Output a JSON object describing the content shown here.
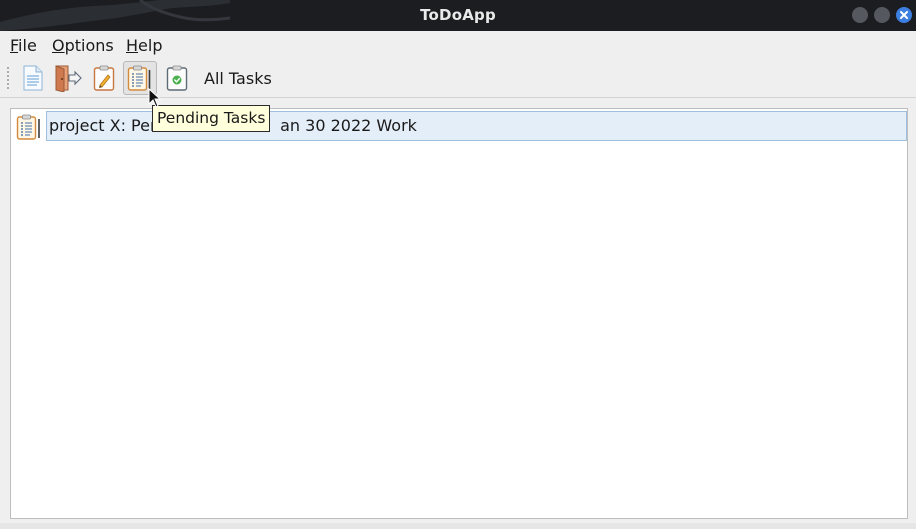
{
  "window": {
    "title": "ToDoApp",
    "accent": "#3d7fe0"
  },
  "menu": [
    {
      "label": "File",
      "mnemonic": "F",
      "rest": "ile"
    },
    {
      "label": "Options",
      "mnemonic": "O",
      "rest": "ptions"
    },
    {
      "label": "Help",
      "mnemonic": "H",
      "rest": "elp"
    }
  ],
  "toolbar": {
    "buttons": [
      {
        "name": "new-task-button",
        "icon": "document-icon"
      },
      {
        "name": "exit-button",
        "icon": "door-exit-icon"
      },
      {
        "name": "edit-task-button",
        "icon": "clipboard-pencil-icon"
      },
      {
        "name": "pending-tasks-button",
        "icon": "clipboard-list-icon",
        "active": true
      },
      {
        "name": "completed-tasks-button",
        "icon": "clipboard-check-icon"
      }
    ],
    "filter_label": "All Tasks"
  },
  "tooltip": {
    "text": "Pending Tasks"
  },
  "tasks": [
    {
      "text_start": "project X: Pen",
      "text_end": "an 30 2022 Work",
      "icon": "clipboard-list-icon",
      "selected": true
    }
  ]
}
